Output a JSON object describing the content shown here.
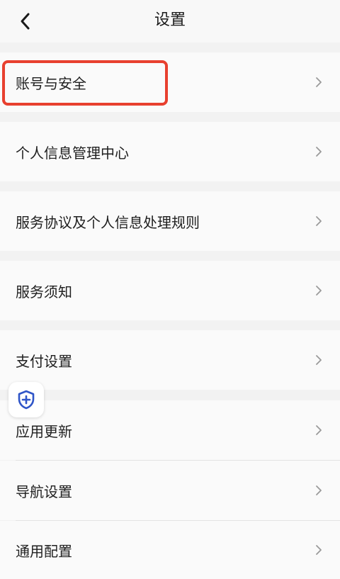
{
  "header": {
    "title": "设置",
    "back_icon": "chevron-left-icon"
  },
  "rows": [
    {
      "label": "账号与安全",
      "highlighted": true
    },
    {
      "label": "个人信息管理中心"
    },
    {
      "label": "服务协议及个人信息处理规则"
    },
    {
      "label": "服务须知"
    },
    {
      "label": "支付设置"
    },
    {
      "label": "应用更新"
    },
    {
      "label": "导航设置"
    },
    {
      "label": "通用配置"
    }
  ],
  "row_chevron_icon": "chevron-right-icon",
  "floating_button": {
    "icon": "shield-plus-icon",
    "color": "#2f55c8"
  },
  "colors": {
    "highlight_border": "#e8402f",
    "background": "#f2f2f2",
    "row_background": "#fafafa"
  }
}
